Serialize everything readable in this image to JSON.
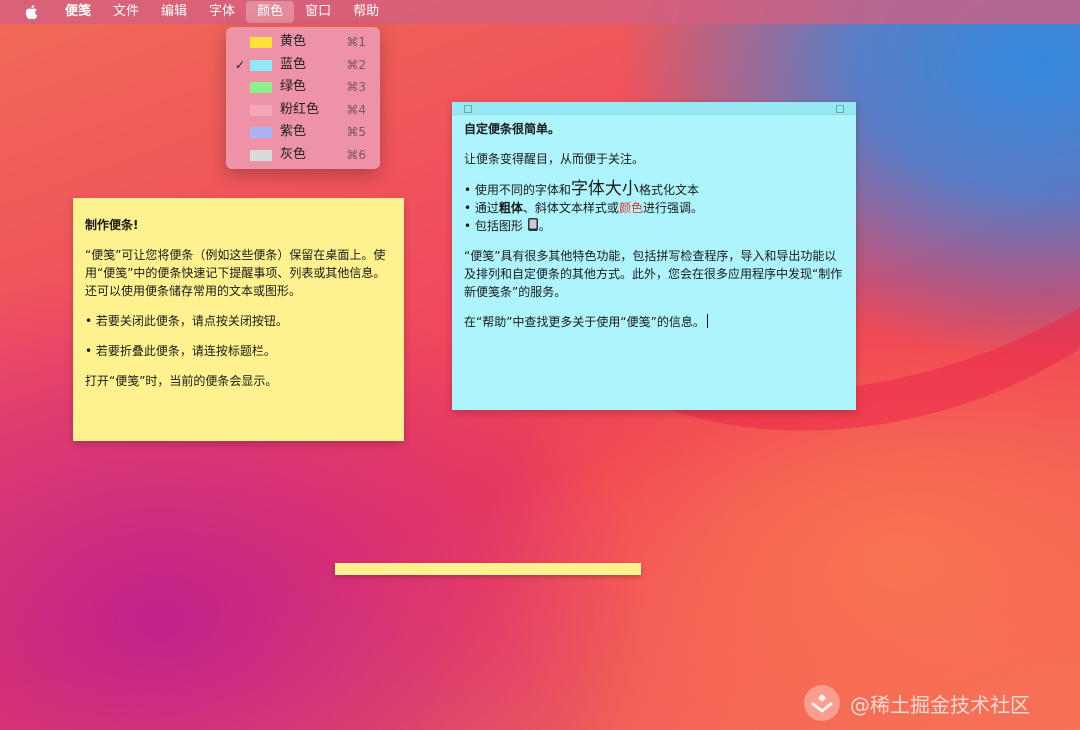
{
  "menubar": {
    "app_name": "便笺",
    "items": [
      "文件",
      "编辑",
      "字体",
      "颜色",
      "窗口",
      "帮助"
    ],
    "active_item": "颜色"
  },
  "color_menu": {
    "items": [
      {
        "label": "黄色",
        "shortcut": "⌘1",
        "color": "#ffe13a",
        "checked": false
      },
      {
        "label": "蓝色",
        "shortcut": "⌘2",
        "color": "#8fe9f7",
        "checked": true
      },
      {
        "label": "绿色",
        "shortcut": "⌘3",
        "color": "#8ff08a",
        "checked": false
      },
      {
        "label": "粉红色",
        "shortcut": "⌘4",
        "color": "#f5a7b8",
        "checked": false
      },
      {
        "label": "紫色",
        "shortcut": "⌘5",
        "color": "#a9b4f7",
        "checked": false
      },
      {
        "label": "灰色",
        "shortcut": "⌘6",
        "color": "#dadada",
        "checked": false
      }
    ]
  },
  "yellow_note": {
    "title": "制作便条!",
    "para1": "“便笺”可让您将便条（例如这些便条）保留在桌面上。使用“便笺”中的便条快速记下提醒事项、列表或其他信息。还可以使用便条储存常用的文本或图形。",
    "para2": "• 若要关闭此便条，请点按关闭按钮。",
    "para3": "• 若要折叠此便条，请连按标题栏。",
    "para4": "打开“便笺”时，当前的便条会显示。"
  },
  "blue_note": {
    "title": "自定便条很简单。",
    "intro": "让便条变得醒目，从而便于关注。",
    "bullet1_a": "• 使用不同的",
    "bullet1_b": "字体",
    "bullet1_c": "和",
    "bullet1_d": "字体大小",
    "bullet1_e": "格式化文本",
    "bullet2_a": "• 通过",
    "bullet2_b": "粗体",
    "bullet2_c": "、斜体文本样式或",
    "bullet2_d": "颜色",
    "bullet2_e": "进行强调。",
    "bullet3": "• 包括图形",
    "para_features": "“便笺”具有很多其他特色功能，包括拼写检查程序，导入和导出功能以及排列和自定便条的其他方式。此外，您会在很多应用程序中发现“制作新便笺条”的服务。",
    "para_help": "在“帮助”中查找更多关于使用“便笺”的信息。"
  },
  "watermark": {
    "text": "@稀土掘金技术社区"
  }
}
